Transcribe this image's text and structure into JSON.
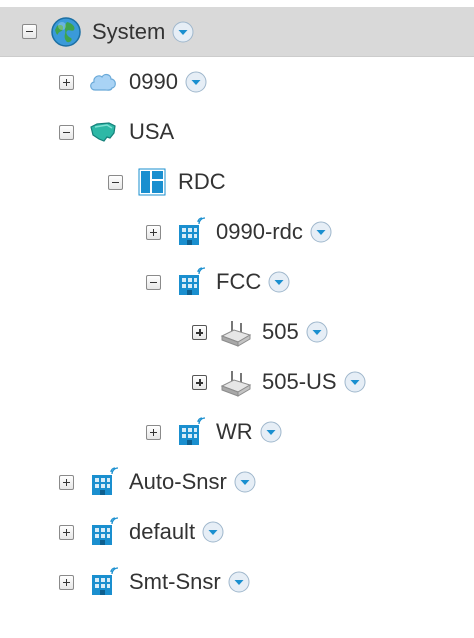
{
  "tree": {
    "root": {
      "label": "System"
    },
    "location_0990": {
      "label": "0990"
    },
    "usa": {
      "label": "USA"
    },
    "rdc": {
      "label": "RDC"
    },
    "b_0990_rdc": {
      "label": "0990-rdc"
    },
    "fcc": {
      "label": "FCC"
    },
    "ap_505": {
      "label": "505"
    },
    "ap_505_us": {
      "label": "505-US"
    },
    "wr": {
      "label": "WR"
    },
    "auto_snsr": {
      "label": "Auto-Snsr"
    },
    "default": {
      "label": "default"
    },
    "smt_snsr": {
      "label": "Smt-Snsr"
    }
  },
  "icons": {
    "globe": "globe-icon",
    "cloud": "cloud-icon",
    "map": "country-map-icon",
    "floorplan": "floorplan-icon",
    "building": "building-icon",
    "access_point": "access-point-icon",
    "menu": "chevron-down-icon"
  },
  "colors": {
    "selected_row": "#d9d9d9",
    "accent_blue": "#1a8fcf",
    "text": "#333333"
  }
}
